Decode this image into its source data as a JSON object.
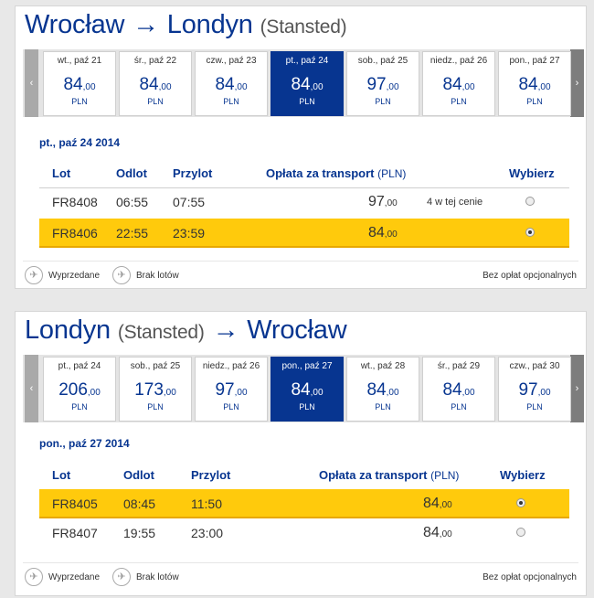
{
  "outbound": {
    "origin": "Wrocław",
    "arrow": "→",
    "dest": "Londyn",
    "dest_airport": "(Stansted)",
    "days": [
      {
        "label": "wt., paź 21",
        "int": "84",
        "dec": ",00",
        "cur": "PLN"
      },
      {
        "label": "śr., paź 22",
        "int": "84",
        "dec": ",00",
        "cur": "PLN"
      },
      {
        "label": "czw., paź 23",
        "int": "84",
        "dec": ",00",
        "cur": "PLN"
      },
      {
        "label": "pt., paź 24",
        "int": "84",
        "dec": ",00",
        "cur": "PLN"
      },
      {
        "label": "sob., paź 25",
        "int": "97",
        "dec": ",00",
        "cur": "PLN"
      },
      {
        "label": "niedz., paź 26",
        "int": "84",
        "dec": ",00",
        "cur": "PLN"
      },
      {
        "label": "pon., paź 27",
        "int": "84",
        "dec": ",00",
        "cur": "PLN"
      }
    ],
    "selected_day": 3,
    "date_title": "pt., paź 24 2014",
    "headers": {
      "lot": "Lot",
      "odlot": "Odlot",
      "przylot": "Przylot",
      "oplata": "Opłata za transport",
      "unit": "(PLN)",
      "wybierz": "Wybierz"
    },
    "flights": [
      {
        "num": "FR8408",
        "dep": "06:55",
        "arr": "07:55",
        "int": "97",
        "dec": ",00",
        "note": "4 w tej cenie",
        "selected": false
      },
      {
        "num": "FR8406",
        "dep": "22:55",
        "arr": "23:59",
        "int": "84",
        "dec": ",00",
        "note": "",
        "selected": true
      }
    ]
  },
  "inbound": {
    "origin": "Londyn",
    "origin_airport": "(Stansted)",
    "arrow": "→",
    "dest": "Wrocław",
    "days": [
      {
        "label": "pt., paź 24",
        "int": "206",
        "dec": ",00",
        "cur": "PLN"
      },
      {
        "label": "sob., paź 25",
        "int": "173",
        "dec": ",00",
        "cur": "PLN"
      },
      {
        "label": "niedz., paź 26",
        "int": "97",
        "dec": ",00",
        "cur": "PLN"
      },
      {
        "label": "pon., paź 27",
        "int": "84",
        "dec": ",00",
        "cur": "PLN"
      },
      {
        "label": "wt., paź 28",
        "int": "84",
        "dec": ",00",
        "cur": "PLN"
      },
      {
        "label": "śr., paź 29",
        "int": "84",
        "dec": ",00",
        "cur": "PLN"
      },
      {
        "label": "czw., paź 30",
        "int": "97",
        "dec": ",00",
        "cur": "PLN"
      }
    ],
    "selected_day": 3,
    "date_title": "pon., paź 27 2014",
    "headers": {
      "lot": "Lot",
      "odlot": "Odlot",
      "przylot": "Przylot",
      "oplata": "Opłata za transport",
      "unit": "(PLN)",
      "wybierz": "Wybierz"
    },
    "flights": [
      {
        "num": "FR8405",
        "dep": "08:45",
        "arr": "11:50",
        "int": "84",
        "dec": ",00",
        "note": "",
        "selected": true
      },
      {
        "num": "FR8407",
        "dep": "19:55",
        "arr": "23:00",
        "int": "84",
        "dec": ",00",
        "note": "",
        "selected": false
      }
    ]
  },
  "legend": {
    "sold_out": "Wyprzedane",
    "no_flights": "Brak lotów",
    "no_optional": "Bez opłat opcjonalnych"
  },
  "nav": {
    "prev": "‹",
    "next": "›"
  },
  "icons": {
    "sold_out": "sold-out-icon",
    "no_flights": "no-flights-icon"
  },
  "colors": {
    "brand": "#073590",
    "highlight": "#ffca0c"
  }
}
